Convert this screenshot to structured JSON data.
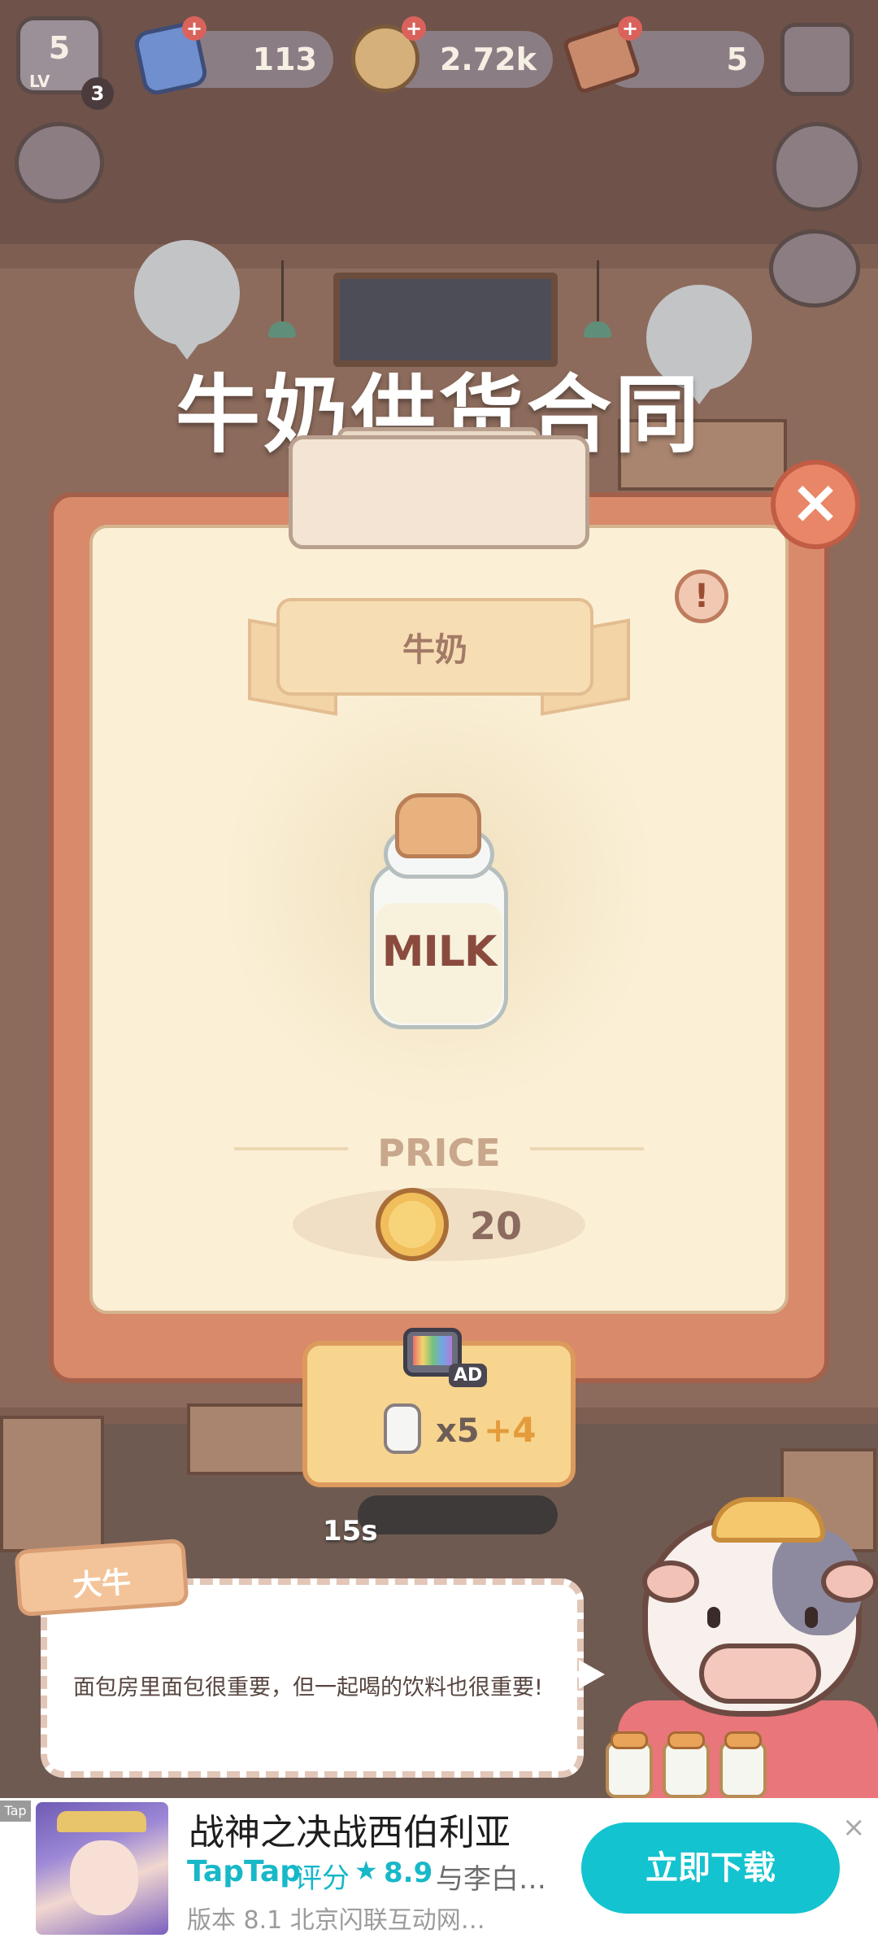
{
  "hud": {
    "level": "5",
    "level_label": "LV",
    "level_badge": "3",
    "gems": "113",
    "coins": "2.72k",
    "tickets": "5"
  },
  "modal": {
    "title": "牛奶供货合同",
    "item_name": "牛奶",
    "item_label": "MILK",
    "price_label": "PRICE",
    "price_value": "20",
    "ad_label": "AD",
    "ad_multiplier": "x5",
    "ad_bonus": "+4",
    "timer": "15s"
  },
  "dialogue": {
    "speaker": "大牛",
    "text": "面包房里面包很重要，但一起喝的饮料也很重要!"
  },
  "ad_banner": {
    "tag": "Tap",
    "title": "战神之决战西伯利亚",
    "brand": "TapTap",
    "rating_label": "评分",
    "rating": "8.9",
    "extra": "与李白…",
    "meta": "版本 8.1   北京闪联互动网…",
    "cta": "立即下载",
    "close": "×"
  },
  "colors": {
    "cta_bg": "#13c3cf",
    "close_button": "#e98668",
    "card_bg": "#fbf0d6",
    "clipboard": "#d98a6a"
  }
}
